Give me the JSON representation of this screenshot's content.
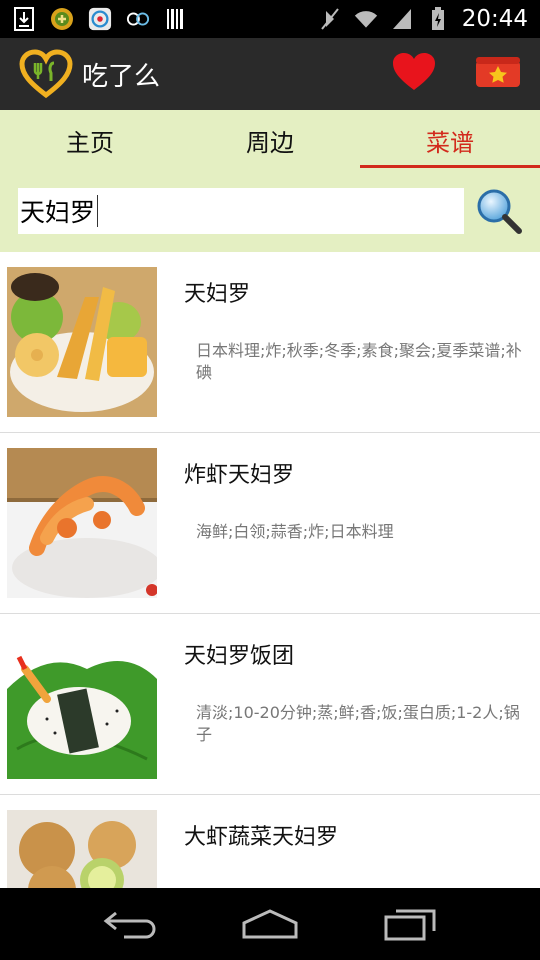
{
  "status_bar": {
    "time": "20:44",
    "left_icons": [
      "download-icon",
      "app-notification-icon",
      "camera-app-icon",
      "infinity-app-icon",
      "barcode-icon"
    ],
    "right_icons": [
      "mute-icon",
      "wifi-icon",
      "signal-icon",
      "battery-charging-icon"
    ]
  },
  "app_bar": {
    "title": "吃了么",
    "brand_color": "#f0b020",
    "favorite_color": "#e8141c"
  },
  "tabs": [
    {
      "label": "主页",
      "active": false
    },
    {
      "label": "周边",
      "active": false
    },
    {
      "label": "菜谱",
      "active": true
    }
  ],
  "accent_color": "#d22a1c",
  "search": {
    "value": "天妇罗",
    "placeholder": ""
  },
  "recipes": [
    {
      "title": "天妇罗",
      "tags": "日本料理;炸;秋季;冬季;素食;聚会;夏季菜谱;补碘"
    },
    {
      "title": "炸虾天妇罗",
      "tags": "海鲜;白领;蒜香;炸;日本料理"
    },
    {
      "title": "天妇罗饭团",
      "tags": "清淡;10-20分钟;蒸;鲜;香;饭;蛋白质;1-2人;锅子"
    },
    {
      "title": "大虾蔬菜天妇罗",
      "tags": ""
    }
  ],
  "nav_bar": {
    "buttons": [
      "back-icon",
      "home-icon",
      "recent-apps-icon"
    ]
  }
}
